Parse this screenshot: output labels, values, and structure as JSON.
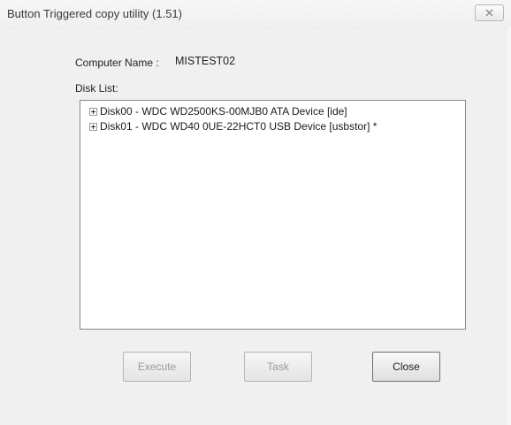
{
  "window": {
    "title": "Button Triggered copy utility (1.51)",
    "close_icon": "close-x-icon"
  },
  "computer": {
    "label": "Computer Name :",
    "value": "MISTEST02"
  },
  "disk_list": {
    "label": "Disk List:",
    "items": [
      {
        "label": "Disk00 - WDC WD2500KS-00MJB0 ATA Device [ide]",
        "expander_icon": "plus-box-icon"
      },
      {
        "label": "Disk01 - WDC WD40 0UE-22HCT0 USB Device [usbstor] *",
        "expander_icon": "plus-box-icon"
      }
    ]
  },
  "buttons": {
    "execute": {
      "label": "Execute",
      "enabled": false
    },
    "task": {
      "label": "Task",
      "enabled": false
    },
    "close": {
      "label": "Close",
      "enabled": true
    }
  }
}
